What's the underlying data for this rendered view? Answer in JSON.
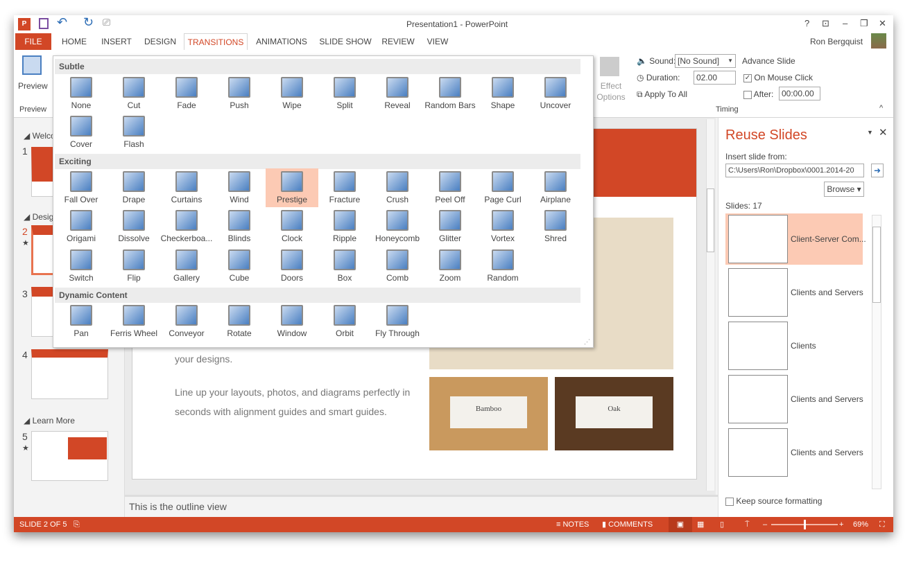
{
  "window": {
    "title": "Presentation1 - PowerPoint",
    "user": "Ron Bergquist",
    "controls": [
      "?",
      "⊡",
      "–",
      "❐",
      "✕"
    ]
  },
  "tabs": [
    {
      "label": "FILE"
    },
    {
      "label": "HOME"
    },
    {
      "label": "INSERT"
    },
    {
      "label": "DESIGN"
    },
    {
      "label": "TRANSITIONS",
      "active": true
    },
    {
      "label": "ANIMATIONS"
    },
    {
      "label": "SLIDE SHOW"
    },
    {
      "label": "REVIEW"
    },
    {
      "label": "VIEW"
    }
  ],
  "ribbon": {
    "preview_label": "Preview",
    "preview_group": "Preview",
    "effect_options": "Effect Options",
    "sound_label": "Sound:",
    "sound_value": "[No Sound]",
    "duration_label": "Duration:",
    "duration_value": "02.00",
    "apply_all": "Apply To All",
    "advance_slide": "Advance Slide",
    "on_mouse_click": "On Mouse Click",
    "on_mouse_click_checked": true,
    "after_label": "After:",
    "after_checked": false,
    "after_value": "00:00.00",
    "timing_group": "Timing"
  },
  "gallery": {
    "sections": [
      {
        "title": "Subtle",
        "items": [
          "None",
          "Cut",
          "Fade",
          "Push",
          "Wipe",
          "Split",
          "Reveal",
          "Random Bars",
          "Shape",
          "Uncover",
          "Cover",
          "Flash"
        ]
      },
      {
        "title": "Exciting",
        "items": [
          "Fall Over",
          "Drape",
          "Curtains",
          "Wind",
          "Prestige",
          "Fracture",
          "Crush",
          "Peel Off",
          "Page Curl",
          "Airplane",
          "Origami",
          "Dissolve",
          "Checkerboa...",
          "Blinds",
          "Clock",
          "Ripple",
          "Honeycomb",
          "Glitter",
          "Vortex",
          "Shred",
          "Switch",
          "Flip",
          "Gallery",
          "Cube",
          "Doors",
          "Box",
          "Comb",
          "Zoom",
          "Random"
        ]
      },
      {
        "title": "Dynamic Content",
        "items": [
          "Pan",
          "Ferris Wheel",
          "Conveyor",
          "Rotate",
          "Window",
          "Orbit",
          "Fly Through"
        ]
      }
    ],
    "selected": "Prestige"
  },
  "thumbnails": {
    "sections": [
      "Welco",
      "Desig",
      "Learn More"
    ],
    "slides": [
      "1",
      "2",
      "3",
      "4",
      "5"
    ],
    "current": "2"
  },
  "slide": {
    "text1": "your designs.",
    "text2": "Line up your layouts, photos, and diagrams perfectly in seconds with alignment guides and smart guides.",
    "card1": "Bamboo",
    "card2": "Oak"
  },
  "notes": {
    "text": "This is the outline view"
  },
  "reuse": {
    "title": "Reuse Slides",
    "insert_from": "Insert slide from:",
    "path": "C:\\Users\\Ron\\Dropbox\\0001.2014-20",
    "browse": "Browse",
    "slides_count": "Slides: 17",
    "items": [
      "Client-Server Com...",
      "Clients and Servers",
      "Clients",
      "Clients and Servers",
      "Clients and Servers"
    ],
    "keep_formatting": "Keep source formatting"
  },
  "status": {
    "slide_info": "SLIDE 2 OF 5",
    "notes": "NOTES",
    "comments": "COMMENTS",
    "zoom": "69%",
    "zoom_percent": 69
  },
  "colors": {
    "accent": "#D24726",
    "selected": "#FCCAB4"
  }
}
